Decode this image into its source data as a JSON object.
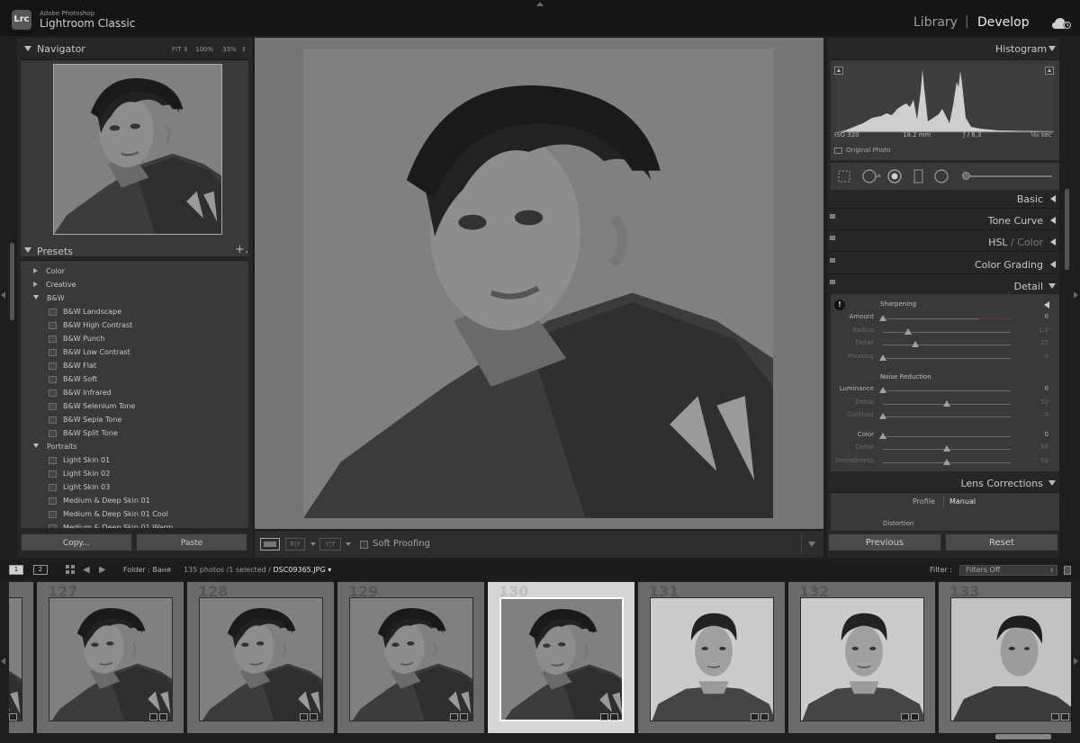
{
  "app": {
    "vendor": "Adobe Photoshop",
    "name": "Lightroom Classic",
    "logo": "Lrc"
  },
  "modules": {
    "library": "Library",
    "separator": "|",
    "develop": "Develop",
    "active": "Develop"
  },
  "icons": {
    "cloud": "cloud-sync-icon",
    "histogram_clip": "clipping-warning-icon",
    "preset": "preset-icon",
    "grid": "grid-icon",
    "lock": "lock-icon"
  },
  "navigator": {
    "title": "Navigator",
    "zoom_options": [
      "FIT ⇕",
      "100%",
      "33%"
    ]
  },
  "presets": {
    "title": "Presets",
    "add": "+.",
    "tree": [
      {
        "type": "folder",
        "label": "Color",
        "expanded": false
      },
      {
        "type": "folder",
        "label": "Creative",
        "expanded": false
      },
      {
        "type": "folder",
        "label": "B&W",
        "expanded": true
      },
      {
        "type": "item",
        "label": "B&W Landscape"
      },
      {
        "type": "item",
        "label": "B&W High Contrast"
      },
      {
        "type": "item",
        "label": "B&W Punch"
      },
      {
        "type": "item",
        "label": "B&W Low Contrast"
      },
      {
        "type": "item",
        "label": "B&W Flat"
      },
      {
        "type": "item",
        "label": "B&W Soft"
      },
      {
        "type": "item",
        "label": "B&W Infrared"
      },
      {
        "type": "item",
        "label": "B&W Selenium Tone"
      },
      {
        "type": "item",
        "label": "B&W Sepia Tone"
      },
      {
        "type": "item",
        "label": "B&W Split Tone"
      },
      {
        "type": "folder",
        "label": "Portraits",
        "expanded": true
      },
      {
        "type": "item",
        "label": "Light Skin 01"
      },
      {
        "type": "item",
        "label": "Light Skin 02"
      },
      {
        "type": "item",
        "label": "Light Skin 03"
      },
      {
        "type": "item",
        "label": "Medium & Deep Skin 01"
      },
      {
        "type": "item",
        "label": "Medium & Deep Skin 01 Cool"
      },
      {
        "type": "item",
        "label": "Medium & Deep Skin 01 Warm"
      }
    ]
  },
  "left_buttons": {
    "copy": "Copy...",
    "paste": "Paste"
  },
  "toolbar": {
    "ry_label": "R|Y",
    "yy_label": "Y|Y",
    "soft_proofing": "Soft Proofing",
    "soft_proofing_checked": false
  },
  "histogram": {
    "title": "Histogram",
    "iso": "ISO 320",
    "focal": "18.2 mm",
    "aperture": "ƒ / 6,3",
    "shutter": "¹⁄₆₀ sec",
    "original_photo": "Original Photo"
  },
  "sections": {
    "basic": "Basic",
    "tone_curve": "Tone Curve",
    "hsl": "HSL",
    "hsl_sep": " / ",
    "color": "Color",
    "color_grading": "Color Grading",
    "detail": "Detail",
    "lens_corrections": "Lens Corrections"
  },
  "detail": {
    "sharpening": {
      "title": "Sharpening",
      "sliders": [
        {
          "label": "Amount",
          "value": "0",
          "pos": 0.0,
          "dim": false
        },
        {
          "label": "Radius",
          "value": "1,0",
          "pos": 0.2,
          "dim": true
        },
        {
          "label": "Detail",
          "value": "25",
          "pos": 0.25,
          "dim": true
        },
        {
          "label": "Masking",
          "value": "0",
          "pos": 0.0,
          "dim": true
        }
      ]
    },
    "noise_reduction": {
      "title": "Noise Reduction",
      "sliders": [
        {
          "label": "Luminance",
          "value": "0",
          "pos": 0.0,
          "dim": false
        },
        {
          "label": "Detail",
          "value": "50",
          "pos": 0.5,
          "dim": true
        },
        {
          "label": "Contrast",
          "value": "0",
          "pos": 0.0,
          "dim": true
        },
        {
          "label": "Color",
          "value": "0",
          "pos": 0.0,
          "dim": false
        },
        {
          "label": "Detail",
          "value": "50",
          "pos": 0.5,
          "dim": true
        },
        {
          "label": "Smoothness",
          "value": "50",
          "pos": 0.5,
          "dim": true
        }
      ]
    }
  },
  "lens": {
    "profile": "Profile",
    "manual": "Manual",
    "distortion": "Distortion"
  },
  "right_buttons": {
    "previous": "Previous",
    "reset": "Reset"
  },
  "film_bar": {
    "page1": "1",
    "page2": "2",
    "folder": "Folder : Ваня",
    "count": "135 photos /1 selected /",
    "filename": "DSC09365.JPG ▾",
    "filter_label": "Filter :",
    "filter_value": "Filters Off"
  },
  "filmstrip": {
    "cells": [
      {
        "num": "",
        "selected": false
      },
      {
        "num": "127",
        "selected": false
      },
      {
        "num": "128",
        "selected": false
      },
      {
        "num": "129",
        "selected": false
      },
      {
        "num": "130",
        "selected": true
      },
      {
        "num": "131",
        "selected": false
      },
      {
        "num": "132",
        "selected": false
      },
      {
        "num": "133",
        "selected": false
      }
    ]
  }
}
